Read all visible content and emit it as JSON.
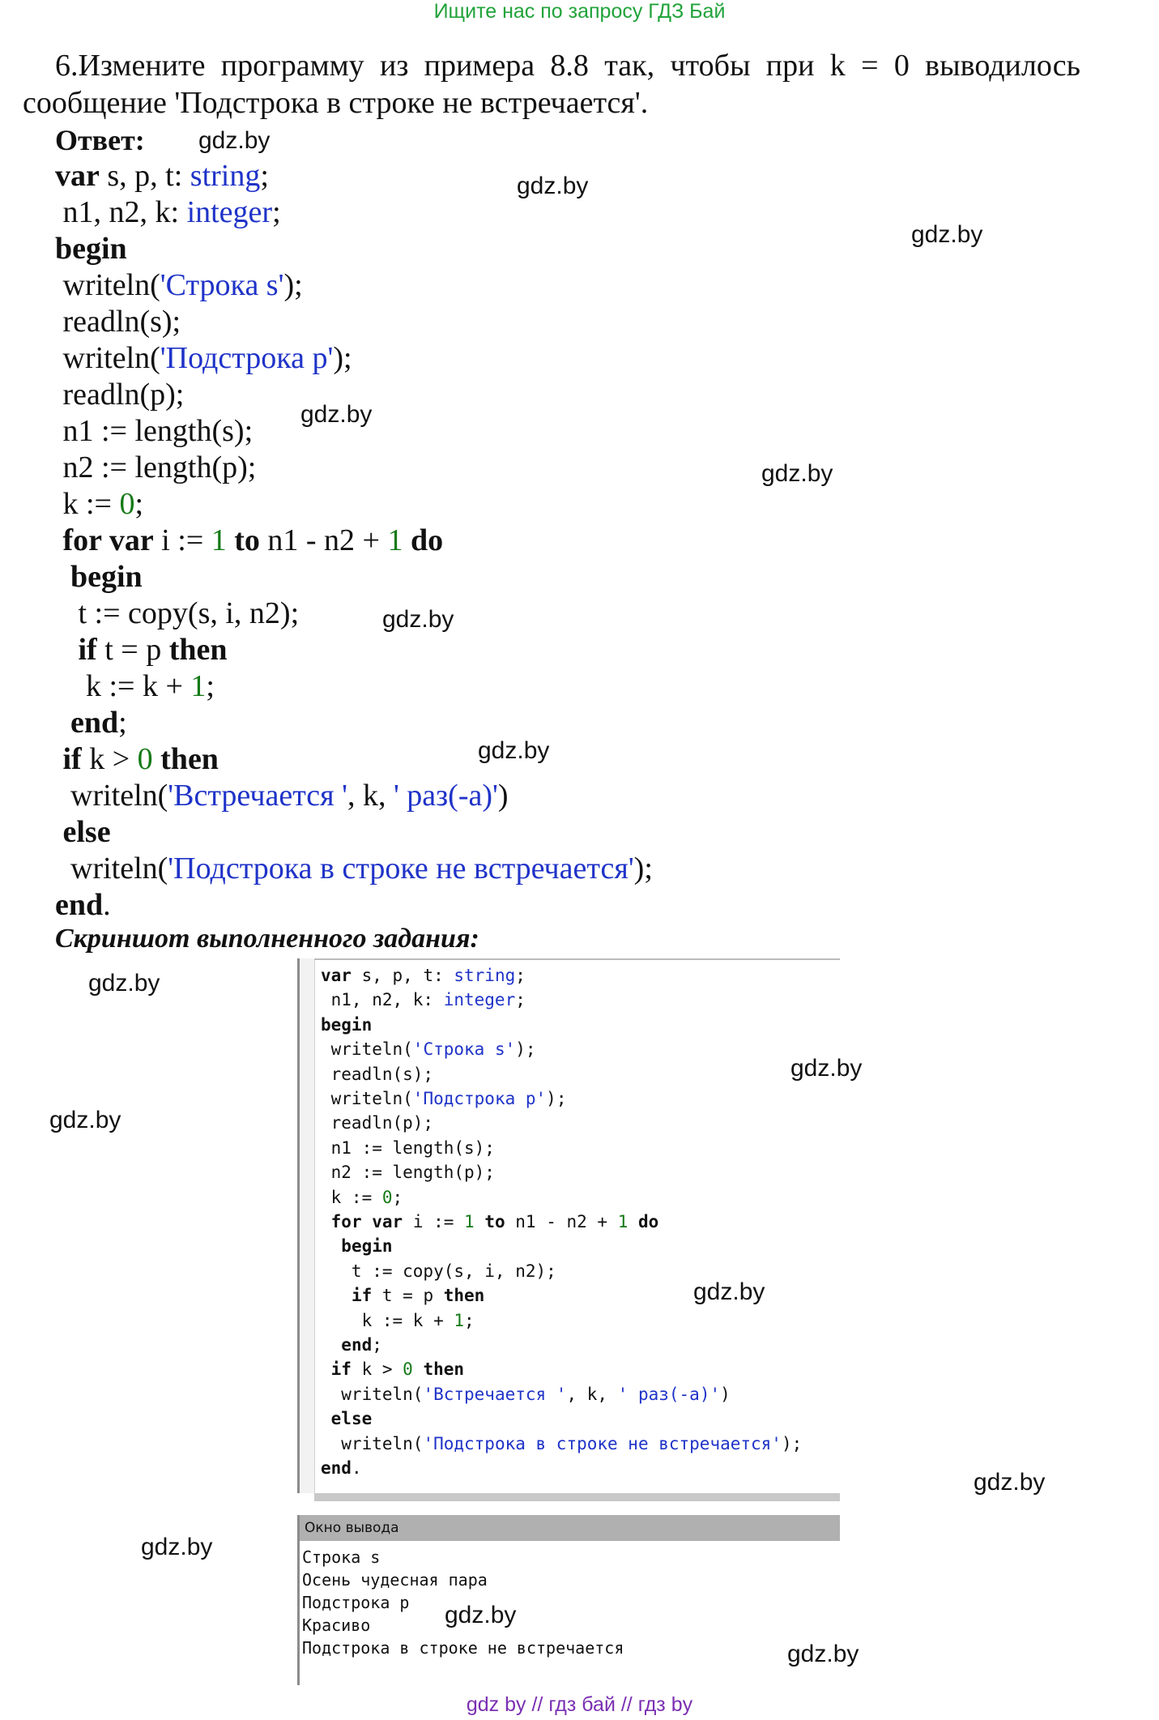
{
  "header": {
    "link_text": "Ищите нас по запросу ГДЗ Бай"
  },
  "task": {
    "line1": "6.Измените программу из примера 8.8 так, чтобы при k = 0 выводилось",
    "line2": "сообщение 'Подстрока в строке не встречается'."
  },
  "answer_label": "Ответ:",
  "code": [
    [
      {
        "t": "var",
        "c": "b"
      },
      {
        "t": " s, p, t: ",
        "c": ""
      },
      {
        "t": "string",
        "c": "t"
      },
      {
        "t": ";",
        "c": ""
      }
    ],
    [
      {
        "t": " n1, n2, k: ",
        "c": ""
      },
      {
        "t": "integer",
        "c": "t"
      },
      {
        "t": ";",
        "c": ""
      }
    ],
    [
      {
        "t": "begin",
        "c": "b"
      }
    ],
    [
      {
        "t": " writeln(",
        "c": ""
      },
      {
        "t": "'Строка s'",
        "c": "s"
      },
      {
        "t": ");",
        "c": ""
      }
    ],
    [
      {
        "t": " readln(s);",
        "c": ""
      }
    ],
    [
      {
        "t": " writeln(",
        "c": ""
      },
      {
        "t": "'Подстрока p'",
        "c": "s"
      },
      {
        "t": ");",
        "c": ""
      }
    ],
    [
      {
        "t": " readln(p);",
        "c": ""
      }
    ],
    [
      {
        "t": " n1 := length(s);",
        "c": ""
      }
    ],
    [
      {
        "t": " n2 := length(p);",
        "c": ""
      }
    ],
    [
      {
        "t": " k := ",
        "c": ""
      },
      {
        "t": "0",
        "c": "n"
      },
      {
        "t": ";",
        "c": ""
      }
    ],
    [
      {
        "t": " ",
        "c": ""
      },
      {
        "t": "for var",
        "c": "b"
      },
      {
        "t": " i := ",
        "c": ""
      },
      {
        "t": "1",
        "c": "n"
      },
      {
        "t": " ",
        "c": ""
      },
      {
        "t": "to",
        "c": "b"
      },
      {
        "t": " n1 - n2 + ",
        "c": ""
      },
      {
        "t": "1",
        "c": "n"
      },
      {
        "t": " ",
        "c": ""
      },
      {
        "t": "do",
        "c": "b"
      }
    ],
    [
      {
        "t": "  ",
        "c": ""
      },
      {
        "t": "begin",
        "c": "b"
      }
    ],
    [
      {
        "t": "   t := copy(s, i, n2);",
        "c": ""
      }
    ],
    [
      {
        "t": "   ",
        "c": ""
      },
      {
        "t": "if",
        "c": "b"
      },
      {
        "t": " t = p ",
        "c": ""
      },
      {
        "t": "then",
        "c": "b"
      }
    ],
    [
      {
        "t": "    k := k + ",
        "c": ""
      },
      {
        "t": "1",
        "c": "n"
      },
      {
        "t": ";",
        "c": ""
      }
    ],
    [
      {
        "t": "  ",
        "c": ""
      },
      {
        "t": "end",
        "c": "b"
      },
      {
        "t": ";",
        "c": ""
      }
    ],
    [
      {
        "t": " ",
        "c": ""
      },
      {
        "t": "if",
        "c": "b"
      },
      {
        "t": " k > ",
        "c": ""
      },
      {
        "t": "0",
        "c": "n"
      },
      {
        "t": " ",
        "c": ""
      },
      {
        "t": "then",
        "c": "b"
      }
    ],
    [
      {
        "t": "  writeln(",
        "c": ""
      },
      {
        "t": "'Встречается '",
        "c": "s"
      },
      {
        "t": ", k, ",
        "c": ""
      },
      {
        "t": "' раз(-а)'",
        "c": "s"
      },
      {
        "t": ")",
        "c": ""
      }
    ],
    [
      {
        "t": " ",
        "c": ""
      },
      {
        "t": "else",
        "c": "b"
      }
    ],
    [
      {
        "t": "  writeln(",
        "c": ""
      },
      {
        "t": "'Подстрока в строке не встречается'",
        "c": "s"
      },
      {
        "t": ");",
        "c": ""
      }
    ],
    [
      {
        "t": "end",
        "c": "b"
      },
      {
        "t": ".",
        "c": ""
      }
    ]
  ],
  "screenshot_label": "Скриншот выполненного задания:",
  "editor_code": [
    [
      {
        "t": "var",
        "c": "b"
      },
      {
        "t": " s, p, t: ",
        "c": ""
      },
      {
        "t": "string",
        "c": "t"
      },
      {
        "t": ";",
        "c": ""
      }
    ],
    [
      {
        "t": " n1, n2, k: ",
        "c": ""
      },
      {
        "t": "integer",
        "c": "t"
      },
      {
        "t": ";",
        "c": ""
      }
    ],
    [
      {
        "t": "begin",
        "c": "b"
      }
    ],
    [
      {
        "t": " writeln(",
        "c": ""
      },
      {
        "t": "'Строка s'",
        "c": "s"
      },
      {
        "t": ");",
        "c": ""
      }
    ],
    [
      {
        "t": " readln(s);",
        "c": ""
      }
    ],
    [
      {
        "t": " writeln(",
        "c": ""
      },
      {
        "t": "'Подстрока p'",
        "c": "s"
      },
      {
        "t": ");",
        "c": ""
      }
    ],
    [
      {
        "t": " readln(p);",
        "c": ""
      }
    ],
    [
      {
        "t": " n1 := length(s);",
        "c": ""
      }
    ],
    [
      {
        "t": " n2 := length(p);",
        "c": ""
      }
    ],
    [
      {
        "t": " k := ",
        "c": ""
      },
      {
        "t": "0",
        "c": "n"
      },
      {
        "t": ";",
        "c": ""
      }
    ],
    [
      {
        "t": " ",
        "c": ""
      },
      {
        "t": "for var",
        "c": "b"
      },
      {
        "t": " i := ",
        "c": ""
      },
      {
        "t": "1",
        "c": "n"
      },
      {
        "t": " ",
        "c": ""
      },
      {
        "t": "to",
        "c": "b"
      },
      {
        "t": " n1 - n2 + ",
        "c": ""
      },
      {
        "t": "1",
        "c": "n"
      },
      {
        "t": " ",
        "c": ""
      },
      {
        "t": "do",
        "c": "b"
      }
    ],
    [
      {
        "t": "  ",
        "c": ""
      },
      {
        "t": "begin",
        "c": "b"
      }
    ],
    [
      {
        "t": "   t := copy(s, i, n2);",
        "c": ""
      }
    ],
    [
      {
        "t": "   ",
        "c": ""
      },
      {
        "t": "if",
        "c": "b"
      },
      {
        "t": " t = p ",
        "c": ""
      },
      {
        "t": "then",
        "c": "b"
      }
    ],
    [
      {
        "t": "    k := k + ",
        "c": ""
      },
      {
        "t": "1",
        "c": "n"
      },
      {
        "t": ";",
        "c": ""
      }
    ],
    [
      {
        "t": "  ",
        "c": ""
      },
      {
        "t": "end",
        "c": "b"
      },
      {
        "t": ";",
        "c": ""
      }
    ],
    [
      {
        "t": " ",
        "c": ""
      },
      {
        "t": "if",
        "c": "b"
      },
      {
        "t": " k > ",
        "c": ""
      },
      {
        "t": "0",
        "c": "n"
      },
      {
        "t": " ",
        "c": ""
      },
      {
        "t": "then",
        "c": "b"
      }
    ],
    [
      {
        "t": "  writeln(",
        "c": ""
      },
      {
        "t": "'Встречается '",
        "c": "s"
      },
      {
        "t": ", k, ",
        "c": ""
      },
      {
        "t": "' раз(-а)'",
        "c": "s"
      },
      {
        "t": ")",
        "c": ""
      }
    ],
    [
      {
        "t": " ",
        "c": ""
      },
      {
        "t": "else",
        "c": "b"
      }
    ],
    [
      {
        "t": "  writeln(",
        "c": ""
      },
      {
        "t": "'Подстрока в строке не встречается'",
        "c": "s"
      },
      {
        "t": ");",
        "c": ""
      }
    ],
    [
      {
        "t": "end",
        "c": "b"
      },
      {
        "t": ".",
        "c": ""
      }
    ]
  ],
  "output_window": {
    "title": "Окно вывода",
    "lines": [
      "Строка s",
      "Осень чудесная пара",
      "Подстрока p",
      "Красиво",
      "Подстрока в строке не встречается"
    ]
  },
  "watermark": "gdz.by",
  "footer": {
    "text": "gdz by  //  гдз бай  //  гдз by"
  },
  "colors": {
    "string": "#1f33c8",
    "number": "#157a17",
    "type": "#1f33c8",
    "top_link": "#21a33a",
    "footer": "#7a2fb3"
  }
}
